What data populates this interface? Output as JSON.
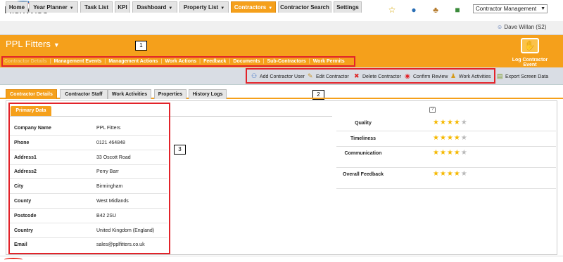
{
  "brand": {
    "logo_text": "RiskWise"
  },
  "header": {
    "module_select": "Contractor Management",
    "user": "Dave Willan (S2)"
  },
  "nav": {
    "tabs": [
      {
        "label": "Home",
        "dropdown": false
      },
      {
        "label": "Year Planner",
        "dropdown": true
      },
      {
        "label": "Task List",
        "dropdown": false
      },
      {
        "label": "KPI",
        "dropdown": false
      },
      {
        "label": "Dashboard",
        "dropdown": true
      },
      {
        "label": "Property List",
        "dropdown": true
      },
      {
        "label": "Contractors",
        "dropdown": true,
        "active": true
      },
      {
        "label": "Contractor Search",
        "dropdown": false
      },
      {
        "label": "Settings",
        "dropdown": false
      }
    ]
  },
  "page": {
    "title": "PPL Fitters",
    "log_event_label": "Log Contractor Event"
  },
  "subnav": {
    "items": [
      "Contractor Details",
      "Management Events",
      "Management Actions",
      "Work Actions",
      "Feedback",
      "Documents",
      "Sub-Contractors",
      "Work Permits"
    ]
  },
  "actions": {
    "add_user": "Add Contractor User",
    "edit": "Edit Contractor",
    "delete": "Delete Contractor",
    "confirm": "Confirm Review",
    "work_activities": "Work Activities",
    "export": "Export Screen Data"
  },
  "content_tabs": [
    "Contractor Details",
    "Contractor Staff",
    "Work Activities",
    "Properties",
    "History Logs"
  ],
  "primary_data": {
    "title": "Primary Data",
    "rows": [
      {
        "label": "Company Name",
        "value": "PPL Fitters"
      },
      {
        "label": "Phone",
        "value": "0121 464848"
      },
      {
        "label": "Address1",
        "value": "33 Oscott Road"
      },
      {
        "label": "Address2",
        "value": "Perry Barr"
      },
      {
        "label": "City",
        "value": "Birmingham"
      },
      {
        "label": "County",
        "value": "West Midlands"
      },
      {
        "label": "Postcode",
        "value": "B42 2SU"
      },
      {
        "label": "Country",
        "value": "United Kingdom (England)"
      },
      {
        "label": "Email",
        "value": "sales@pplfitters.co.uk"
      }
    ]
  },
  "ratings": [
    {
      "label": "Quality",
      "stars": 4,
      "max": 5
    },
    {
      "label": "Timeliness",
      "stars": 4,
      "max": 5
    },
    {
      "label": "Communication",
      "stars": 4,
      "max": 5
    },
    {
      "label": "Overall Feedback",
      "stars": 4,
      "max": 5
    }
  ],
  "callouts": {
    "c1": "1",
    "c2": "2",
    "c3": "3"
  },
  "colors": {
    "accent": "#f5a01b",
    "highlight": "#e2232a",
    "star": "#f5b800"
  }
}
